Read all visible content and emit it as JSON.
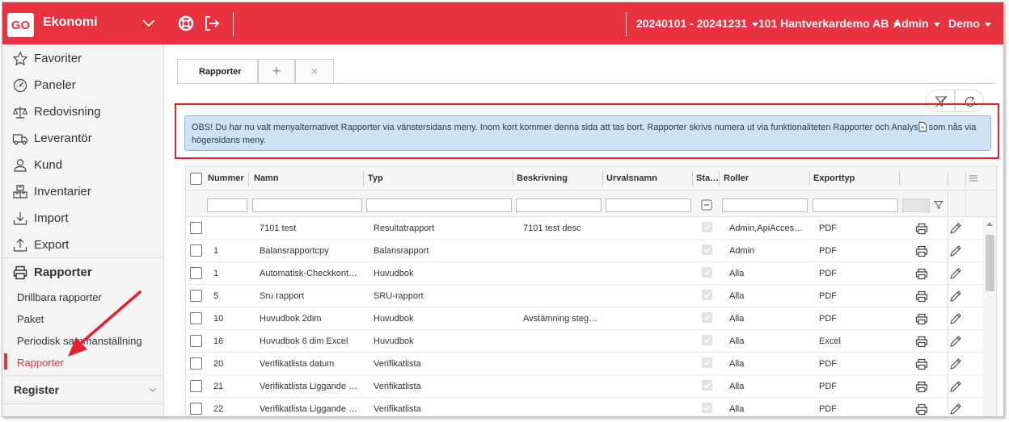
{
  "topbar": {
    "logo": "GO",
    "app_name": "Ekonomi",
    "period": "20240101 - 20241231",
    "company": "101 Hantverkardemo AB",
    "user": "Admin",
    "environment": "Demo",
    "accent": "#e8323f"
  },
  "sidebar": {
    "items": [
      {
        "label": "Favoriter",
        "icon": "star-icon"
      },
      {
        "label": "Paneler",
        "icon": "gauge-icon"
      },
      {
        "label": "Redovisning",
        "icon": "scale-icon"
      },
      {
        "label": "Leverantör",
        "icon": "truck-icon"
      },
      {
        "label": "Kund",
        "icon": "person-icon"
      },
      {
        "label": "Inventarier",
        "icon": "boxes-icon"
      },
      {
        "label": "Import",
        "icon": "import-icon"
      },
      {
        "label": "Export",
        "icon": "export-icon"
      },
      {
        "label": "Rapporter",
        "icon": "printer-icon"
      }
    ],
    "subitems": [
      "Drillbara rapporter",
      "Paket",
      "Periodisk sammanställning",
      "Rapporter"
    ],
    "register": "Register"
  },
  "tabs": {
    "active": "Rapporter",
    "add": "+",
    "close": "×"
  },
  "notice": {
    "text_before": "OBS! Du har nu valt menyalternativet Rapporter via vänstersidans meny. Inom kort kommer denna sida att tas bort. Rapporter skrivs numera ut via funktionaliteten Rapporter och Analys",
    "text_after": " som nås via högersidans meny."
  },
  "grid": {
    "columns": [
      "Nummer",
      "Namn",
      "Typ",
      "Beskrivning",
      "Urvalsnamn",
      "Sta…",
      "Roller",
      "Exporttyp"
    ],
    "rows": [
      {
        "nummer": "",
        "namn": "7101 test",
        "typ": "Resultatrapport",
        "beskrivning": "7101 test desc",
        "roller": "Admin,ApiAcces…",
        "exporttyp": "PDF"
      },
      {
        "nummer": "1",
        "namn": "Balansrapportcpy",
        "typ": "Balansrapport",
        "beskrivning": "",
        "roller": "Admin",
        "exporttyp": "PDF"
      },
      {
        "nummer": "1",
        "namn": "Automatisk-Checkkont…",
        "typ": "Huvudbok",
        "beskrivning": "",
        "roller": "Alla",
        "exporttyp": "PDF"
      },
      {
        "nummer": "5",
        "namn": "Sru rapport",
        "typ": "SRU-rapport",
        "beskrivning": "",
        "roller": "Alla",
        "exporttyp": "PDF"
      },
      {
        "nummer": "10",
        "namn": "Huvudbok 2dim",
        "typ": "Huvudbok",
        "beskrivning": "Avstämning steg…",
        "roller": "Alla",
        "exporttyp": "PDF"
      },
      {
        "nummer": "16",
        "namn": "Huvudbok 6 dim Excel",
        "typ": "Huvudbok",
        "beskrivning": "",
        "roller": "Alla",
        "exporttyp": "Excel"
      },
      {
        "nummer": "20",
        "namn": "Verifikatlista datum",
        "typ": "Verifikatlista",
        "beskrivning": "",
        "roller": "Alla",
        "exporttyp": "PDF"
      },
      {
        "nummer": "21",
        "namn": "Verifikatlista Liggande …",
        "typ": "Verifikatlista",
        "beskrivning": "",
        "roller": "Alla",
        "exporttyp": "PDF"
      },
      {
        "nummer": "22",
        "namn": "Verifikatlista Liggande …",
        "typ": "Verifikatlista",
        "beskrivning": "",
        "roller": "Alla",
        "exporttyp": "PDF"
      }
    ]
  },
  "annotation_color": "#e0232f"
}
